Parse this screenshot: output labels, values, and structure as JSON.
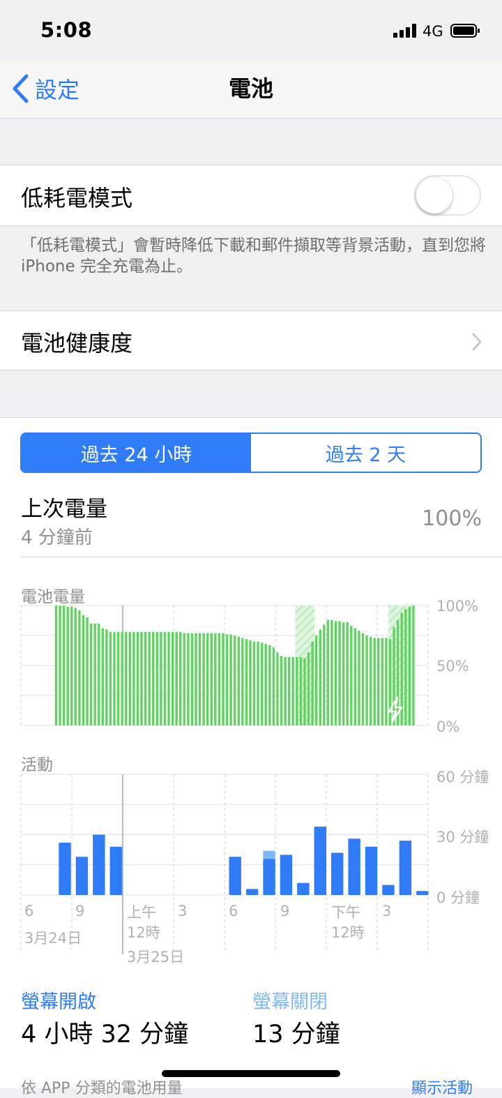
{
  "status_bar": {
    "time": "5:08",
    "network": "4G"
  },
  "nav": {
    "back_label": "設定",
    "title": "電池"
  },
  "low_power": {
    "label": "低耗電模式",
    "enabled": false,
    "footnote": "「低耗電模式」會暫時降低下載和郵件擷取等背景活動，直到您將 iPhone 完全充電為止。"
  },
  "battery_health": {
    "label": "電池健康度"
  },
  "segment": {
    "options": [
      "過去 24 小時",
      "過去 2 天"
    ],
    "selected": 0
  },
  "last_charge": {
    "label": "上次電量",
    "sublabel": "4 分鐘前",
    "value": "100%"
  },
  "colors": {
    "accent": "#2f7cf6",
    "battery_green": "#5fd35f",
    "charging_green": "#c6efc6",
    "activity_blue": "#2f7cf6",
    "activity_light_blue": "#7fb8f5"
  },
  "chart_data": [
    {
      "type": "bar",
      "title": "電池電量",
      "y_ticks": [
        "100%",
        "50%",
        "0%"
      ],
      "ylim": [
        0,
        100
      ],
      "values": [
        100,
        100,
        100,
        99,
        99,
        98,
        96,
        92,
        90,
        85,
        85,
        85,
        81,
        80,
        78,
        78,
        78,
        78,
        78,
        78,
        78,
        78,
        78,
        78,
        78,
        78,
        78,
        78,
        78,
        78,
        78,
        78,
        78,
        77,
        77,
        77,
        77,
        77,
        77,
        77,
        77,
        77,
        77,
        77,
        76,
        76,
        75,
        74,
        73,
        72,
        71,
        70,
        70,
        69,
        68,
        67,
        65,
        61,
        58,
        57,
        57,
        57,
        57,
        57,
        56,
        61,
        70,
        75,
        80,
        84,
        88,
        88,
        87,
        87,
        86,
        86,
        83,
        81,
        79,
        77,
        75,
        74,
        73,
        73,
        73,
        73,
        72,
        82,
        88,
        94,
        97,
        99,
        100
      ],
      "charging_hatch_ranges": [
        [
          62,
          67
        ],
        [
          86,
          92
        ]
      ],
      "charging_icon": "lightning-icon"
    },
    {
      "type": "bar",
      "title": "活動",
      "y_ticks": [
        "60 分鐘",
        "30 分鐘",
        "0 分鐘"
      ],
      "ylim": [
        0,
        60
      ],
      "x_tick_labels": [
        "6",
        "9",
        "上午\n12時",
        "3",
        "6",
        "9",
        "下午\n12時",
        "3"
      ],
      "date_labels": [
        "3月24日",
        "3月25日"
      ],
      "values": [
        0,
        0,
        26,
        19,
        30,
        24,
        0,
        0,
        0,
        0,
        0,
        0,
        19,
        3,
        18,
        20,
        6,
        34,
        21,
        28,
        24,
        5,
        27,
        2
      ],
      "screen_off_values": [
        0,
        0,
        0,
        0,
        0,
        0,
        0,
        0,
        0,
        0,
        0,
        0,
        0,
        0,
        4,
        0,
        0,
        0,
        0,
        0,
        0,
        0,
        0,
        0
      ]
    }
  ],
  "usage": {
    "screen_on_label": "螢幕開啟",
    "screen_on_value": "4 小時 32 分鐘",
    "screen_off_label": "螢幕關閉",
    "screen_off_value": "13 分鐘"
  },
  "bottom": {
    "label": "依 APP 分類的電池用量",
    "link": "顯示活動"
  }
}
